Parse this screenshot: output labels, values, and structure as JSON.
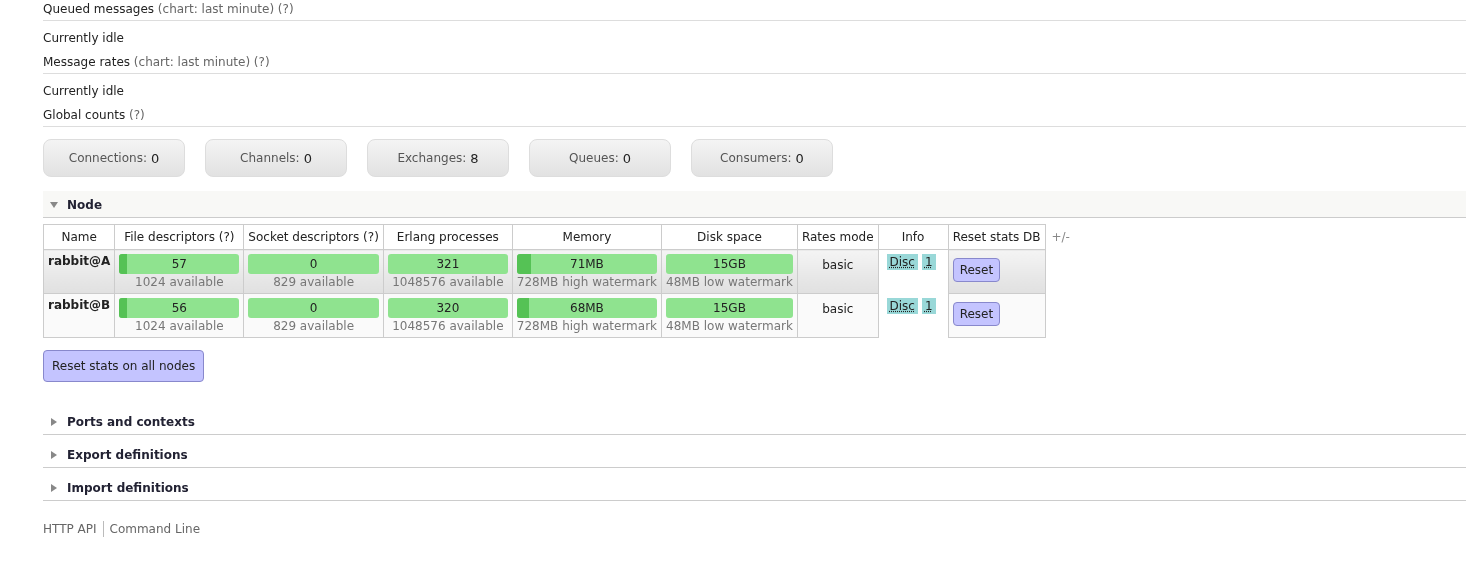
{
  "charts": [
    {
      "title": "Queued messages",
      "hint": "(chart: last minute) (?)",
      "status": "Currently idle"
    },
    {
      "title": "Message rates",
      "hint": "(chart: last minute) (?)",
      "status": "Currently idle"
    }
  ],
  "global_counts": {
    "title": "Global counts",
    "hint": "(?)",
    "counts": [
      {
        "label": "Connections:",
        "value": "0"
      },
      {
        "label": "Channels:",
        "value": "0"
      },
      {
        "label": "Exchanges:",
        "value": "8"
      },
      {
        "label": "Queues:",
        "value": "0"
      },
      {
        "label": "Consumers:",
        "value": "0"
      }
    ]
  },
  "node_section": {
    "title": "Node",
    "expanded": true
  },
  "table": {
    "columns": [
      "Name",
      "File descriptors (?)",
      "Socket descriptors (?)",
      "Erlang processes",
      "Memory",
      "Disk space",
      "Rates mode",
      "Info",
      "Reset stats DB"
    ],
    "toggle": "+/-",
    "rows": [
      {
        "name": "rabbit@A",
        "bars": [
          {
            "value": "57",
            "note": "1024 available",
            "level": 0.06
          },
          {
            "value": "0",
            "note": "829 available"
          },
          {
            "value": "321",
            "note": "1048576 available"
          },
          {
            "value": "71MB",
            "note": "728MB high watermark",
            "level": 0.1
          },
          {
            "value": "15GB",
            "note": "48MB low watermark"
          }
        ],
        "rates_mode": "basic",
        "info": [
          "Disc",
          "1"
        ],
        "reset": "Reset"
      },
      {
        "name": "rabbit@B",
        "bars": [
          {
            "value": "56",
            "note": "1024 available",
            "level": 0.06
          },
          {
            "value": "0",
            "note": "829 available"
          },
          {
            "value": "320",
            "note": "1048576 available"
          },
          {
            "value": "68MB",
            "note": "728MB high watermark",
            "level": 0.09
          },
          {
            "value": "15GB",
            "note": "48MB low watermark"
          }
        ],
        "rates_mode": "basic",
        "info": [
          "Disc",
          "1"
        ],
        "reset": "Reset"
      }
    ]
  },
  "reset_all": "Reset stats on all nodes",
  "sections": [
    {
      "title": "Ports and contexts",
      "expanded": false
    },
    {
      "title": "Export definitions",
      "expanded": false
    },
    {
      "title": "Import definitions",
      "expanded": false
    }
  ],
  "footer_links": [
    "HTTP API",
    "Command Line"
  ]
}
